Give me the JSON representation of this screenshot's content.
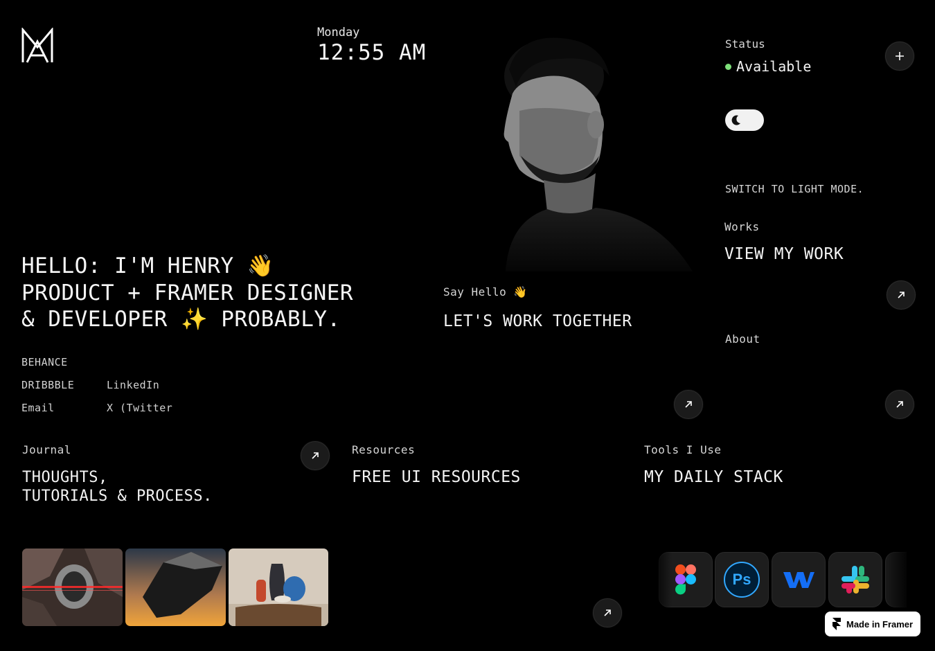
{
  "header": {
    "logo": "MA monogram logo",
    "day": "Monday",
    "time": "12:55 AM"
  },
  "status": {
    "label": "Status",
    "value": "Available",
    "dot_color": "#7ee07a",
    "switch_text": "SWITCH TO LIGHT MODE."
  },
  "works": {
    "label": "Works",
    "title": "VIEW MY WORK"
  },
  "hero": {
    "line1": "HELLO: I'M HENRY 👋",
    "line2": "PRODUCT + FRAMER DESIGNER",
    "line3": "& DEVELOPER ✨ PROBABLY."
  },
  "socials": {
    "behance": "BEHANCE",
    "dribbble": "DRIBBBLE",
    "linkedin": "LinkedIn",
    "email": "Email",
    "twitter": "X (Twitter)"
  },
  "say_hello": {
    "label": "Say Hello 👋",
    "title": "LET'S WORK TOGETHER"
  },
  "about": {
    "label": "About"
  },
  "journal": {
    "label": "Journal",
    "title_line1": "THOUGHTS,",
    "title_line2": "TUTORIALS & PROCESS."
  },
  "resources": {
    "label": "Resources",
    "title": "FREE UI RESOURCES"
  },
  "tools": {
    "label": "Tools I Use",
    "title": "MY DAILY STACK",
    "items": [
      "figma-icon",
      "photoshop-icon",
      "webflow-icon",
      "slack-icon"
    ],
    "ps_text": "Ps"
  },
  "badge": {
    "label": "Made in Framer"
  },
  "colors": {
    "background": "#000000",
    "text": "#f2f2f2",
    "button": "#1b1b1b"
  }
}
